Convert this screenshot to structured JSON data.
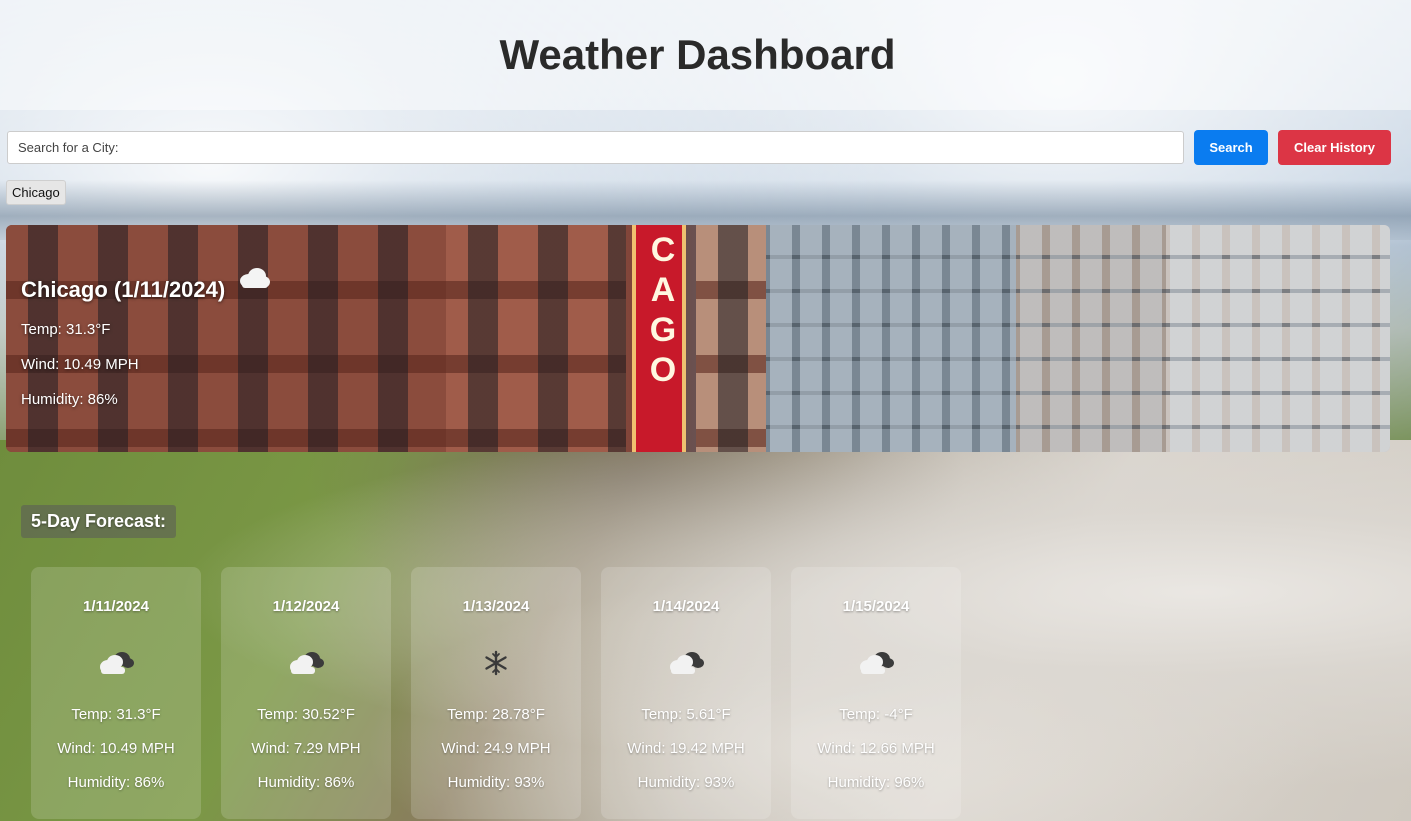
{
  "header": {
    "title": "Weather Dashboard"
  },
  "search": {
    "placeholder": "Search for a City:",
    "search_label": "Search",
    "clear_label": "Clear History"
  },
  "history": [
    {
      "label": "Chicago"
    }
  ],
  "current": {
    "title": "Chicago (1/11/2024)",
    "icon": "cloud-icon",
    "temp": "Temp: 31.3°F",
    "wind": "Wind: 10.49 MPH",
    "humidity": "Humidity: 86%",
    "sign_text": "CAGO"
  },
  "forecast": {
    "heading": "5-Day Forecast:",
    "days": [
      {
        "date": "1/11/2024",
        "icon": "clouds-icon",
        "temp": "Temp: 31.3°F",
        "wind": "Wind: 10.49 MPH",
        "humidity": "Humidity: 86%"
      },
      {
        "date": "1/12/2024",
        "icon": "clouds-icon",
        "temp": "Temp: 30.52°F",
        "wind": "Wind: 7.29 MPH",
        "humidity": "Humidity: 86%"
      },
      {
        "date": "1/13/2024",
        "icon": "snow-icon",
        "temp": "Temp: 28.78°F",
        "wind": "Wind: 24.9 MPH",
        "humidity": "Humidity: 93%"
      },
      {
        "date": "1/14/2024",
        "icon": "clouds-icon",
        "temp": "Temp: 5.61°F",
        "wind": "Wind: 19.42 MPH",
        "humidity": "Humidity: 93%"
      },
      {
        "date": "1/15/2024",
        "icon": "clouds-icon",
        "temp": "Temp: -4°F",
        "wind": "Wind: 12.66 MPH",
        "humidity": "Humidity: 96%"
      }
    ]
  },
  "colors": {
    "search_button": "#0a7cf0",
    "clear_button": "#dc3545"
  }
}
